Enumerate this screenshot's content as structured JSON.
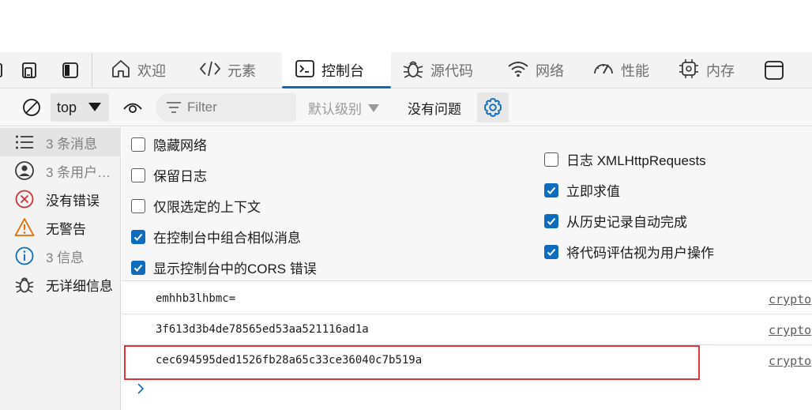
{
  "tabs": [
    {
      "label": "欢迎",
      "icon": "home-icon"
    },
    {
      "label": "元素",
      "icon": "code-icon"
    },
    {
      "label": "控制台",
      "icon": "console-icon",
      "active": true
    },
    {
      "label": "源代码",
      "icon": "bug-icon"
    },
    {
      "label": "网络",
      "icon": "wifi-icon"
    },
    {
      "label": "性能",
      "icon": "gauge-icon"
    },
    {
      "label": "内存",
      "icon": "chip-icon"
    }
  ],
  "toolbar": {
    "context": "top",
    "filter_placeholder": "Filter",
    "levels": "默认级别",
    "issues": "没有问题"
  },
  "sidebar": {
    "items": [
      {
        "label": "3 条消息",
        "icon": "list-icon"
      },
      {
        "label": "3 条用户…",
        "icon": "user-icon"
      },
      {
        "label": "没有错误",
        "icon": "error-icon"
      },
      {
        "label": "无警告",
        "icon": "warning-icon"
      },
      {
        "label": "3 信息",
        "icon": "info-icon"
      },
      {
        "label": "无详细信息",
        "icon": "bug-icon"
      }
    ]
  },
  "settings": {
    "left": [
      {
        "label": "隐藏网络",
        "checked": false
      },
      {
        "label": "保留日志",
        "checked": false
      },
      {
        "label": "仅限选定的上下文",
        "checked": false
      },
      {
        "label": "在控制台中组合相似消息",
        "checked": true
      },
      {
        "label": "显示控制台中的CORS 错误",
        "checked": true
      }
    ],
    "right": [
      {
        "label": "日志 XMLHttpRequests",
        "checked": false
      },
      {
        "label": "立即求值",
        "checked": true
      },
      {
        "label": "从历史记录自动完成",
        "checked": true
      },
      {
        "label": "将代码评估视为用户操作",
        "checked": true
      }
    ]
  },
  "console": {
    "messages": [
      {
        "text": "emhhb3lhbmc=",
        "source": "crypto"
      },
      {
        "text": "3f613d3b4de78565ed53aa521116ad1a",
        "source": "crypto"
      },
      {
        "text": "cec694595ded1526fb28a65c33ce36040c7b519a",
        "source": "crypto"
      }
    ]
  },
  "colors": {
    "accent": "#0f6cbd",
    "highlight": "#e0353a",
    "error": "#d13438",
    "warning": "#e06c00",
    "info": "#0f6cbd"
  }
}
